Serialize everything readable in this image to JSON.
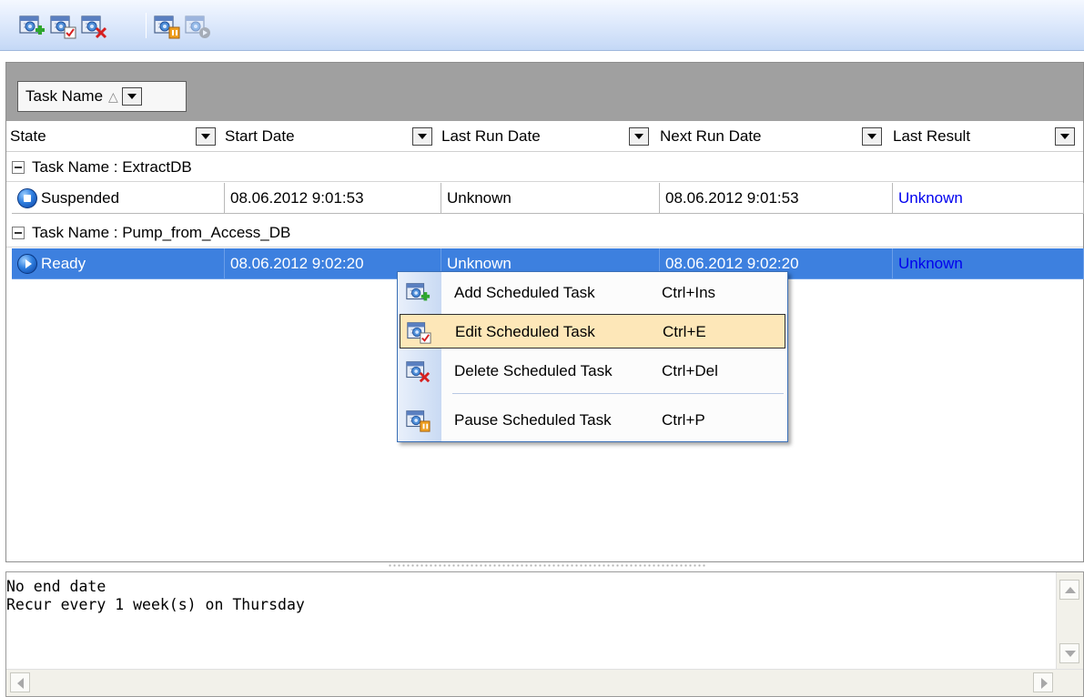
{
  "toolbar": {
    "buttons": [
      {
        "name": "add-scheduled-task",
        "icon": "calendar-gear-add-icon"
      },
      {
        "name": "edit-scheduled-task",
        "icon": "calendar-gear-edit-icon"
      },
      {
        "name": "delete-scheduled-task",
        "icon": "calendar-gear-delete-icon"
      },
      {
        "name": "pause-scheduled-task",
        "icon": "calendar-gear-pause-icon"
      },
      {
        "name": "run-scheduled-task",
        "icon": "calendar-gear-run-icon"
      }
    ]
  },
  "grid": {
    "group_by": {
      "label": "Task Name",
      "sort_glyph": "△"
    },
    "columns": [
      "State",
      "Start Date",
      "Last Run Date",
      "Next Run Date",
      "Last Result"
    ],
    "groups": [
      {
        "label": "Task Name : ExtractDB",
        "row": {
          "state": "Suspended",
          "state_icon": "stop-icon",
          "start_date": "08.06.2012 9:01:53",
          "last_run_date": "Unknown",
          "next_run_date": "08.06.2012 9:01:53",
          "last_result": "Unknown",
          "selected": false
        }
      },
      {
        "label": "Task Name : Pump_from_Access_DB",
        "row": {
          "state": "Ready",
          "state_icon": "play-icon",
          "start_date": "08.06.2012 9:02:20",
          "last_run_date": "Unknown",
          "next_run_date": "08.06.2012 9:02:20",
          "last_result": "Unknown",
          "selected": true
        }
      }
    ]
  },
  "context_menu": {
    "items": [
      {
        "label": "Add Scheduled Task",
        "shortcut": "Ctrl+Ins",
        "icon": "calendar-gear-add-icon",
        "highlighted": false
      },
      {
        "label": "Edit Scheduled Task",
        "shortcut": "Ctrl+E",
        "icon": "calendar-gear-edit-icon",
        "highlighted": true
      },
      {
        "label": "Delete Scheduled Task",
        "shortcut": "Ctrl+Del",
        "icon": "calendar-gear-delete-icon",
        "highlighted": false
      },
      {
        "label": "Pause Scheduled Task",
        "shortcut": "Ctrl+P",
        "icon": "calendar-gear-pause-icon",
        "highlighted": false
      }
    ]
  },
  "details": {
    "line1": "No end date",
    "line2": "Recur every 1 week(s) on Thursday"
  },
  "colors": {
    "toolbar_gradient_top": "#f4f8ff",
    "toolbar_gradient_bottom": "#c4d8f6",
    "group_panel": "#a0a0a0",
    "selection": "#3d80df",
    "menu_highlight": "#fde7b8",
    "link": "#0000ee"
  }
}
